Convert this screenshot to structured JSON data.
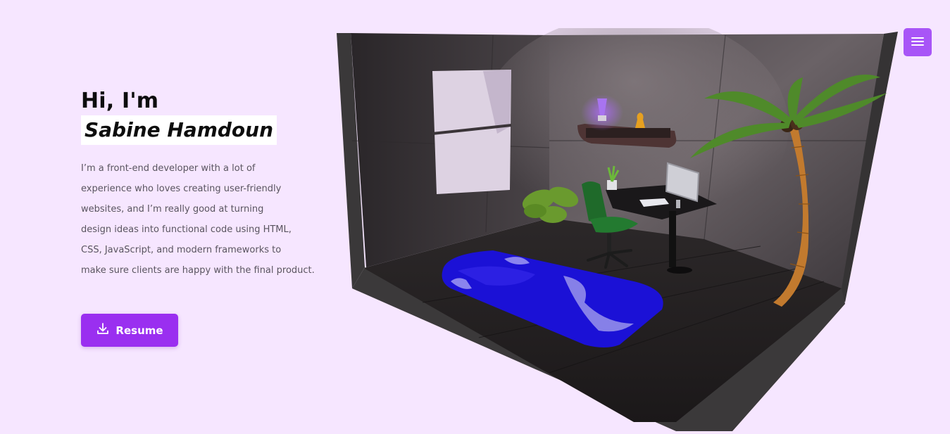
{
  "hero": {
    "greeting": "Hi, I'm",
    "name": "Sabine Hamdoun",
    "bio": "I’m a front-end developer with a lot of\nexperience who loves creating user-friendly\nwebsites, and I’m really good at turning\ndesign ideas into functional code using HTML,\nCSS, JavaScript, and modern frameworks to\nmake sure clients are happy with the final product.",
    "resume_label": "Resume",
    "resume_icon": "download-icon"
  },
  "nav": {
    "menu_icon": "hamburger-menu-icon"
  },
  "colors": {
    "background": "#f6e6ff",
    "accent": "#9a2ff0",
    "menu_button": "#a855f7",
    "name_highlight": "#ffffff"
  },
  "scene": {
    "description_icon": "isometric-room-illustration"
  }
}
